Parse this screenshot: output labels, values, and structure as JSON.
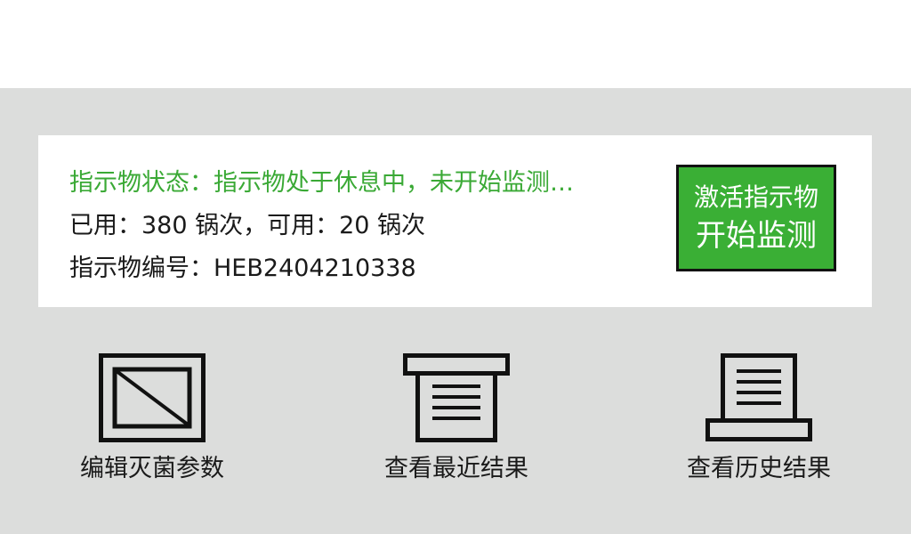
{
  "card": {
    "status_text": "指示物状态：指示物处于休息中，未开始监测…",
    "usage_text": "已用：380 锅次，可用：20 锅次",
    "serial_text": "指示物编号：HEB2404210338",
    "status_color": "#3aa935"
  },
  "activate_button": {
    "line1": "激活指示物",
    "line2": "开始监测",
    "color": "#3aaf35"
  },
  "tiles": [
    {
      "label": "编辑灭菌参数",
      "icon": "edit-params-icon"
    },
    {
      "label": "查看最近结果",
      "icon": "recent-result-icon"
    },
    {
      "label": "查看历史结果",
      "icon": "history-result-icon"
    }
  ]
}
